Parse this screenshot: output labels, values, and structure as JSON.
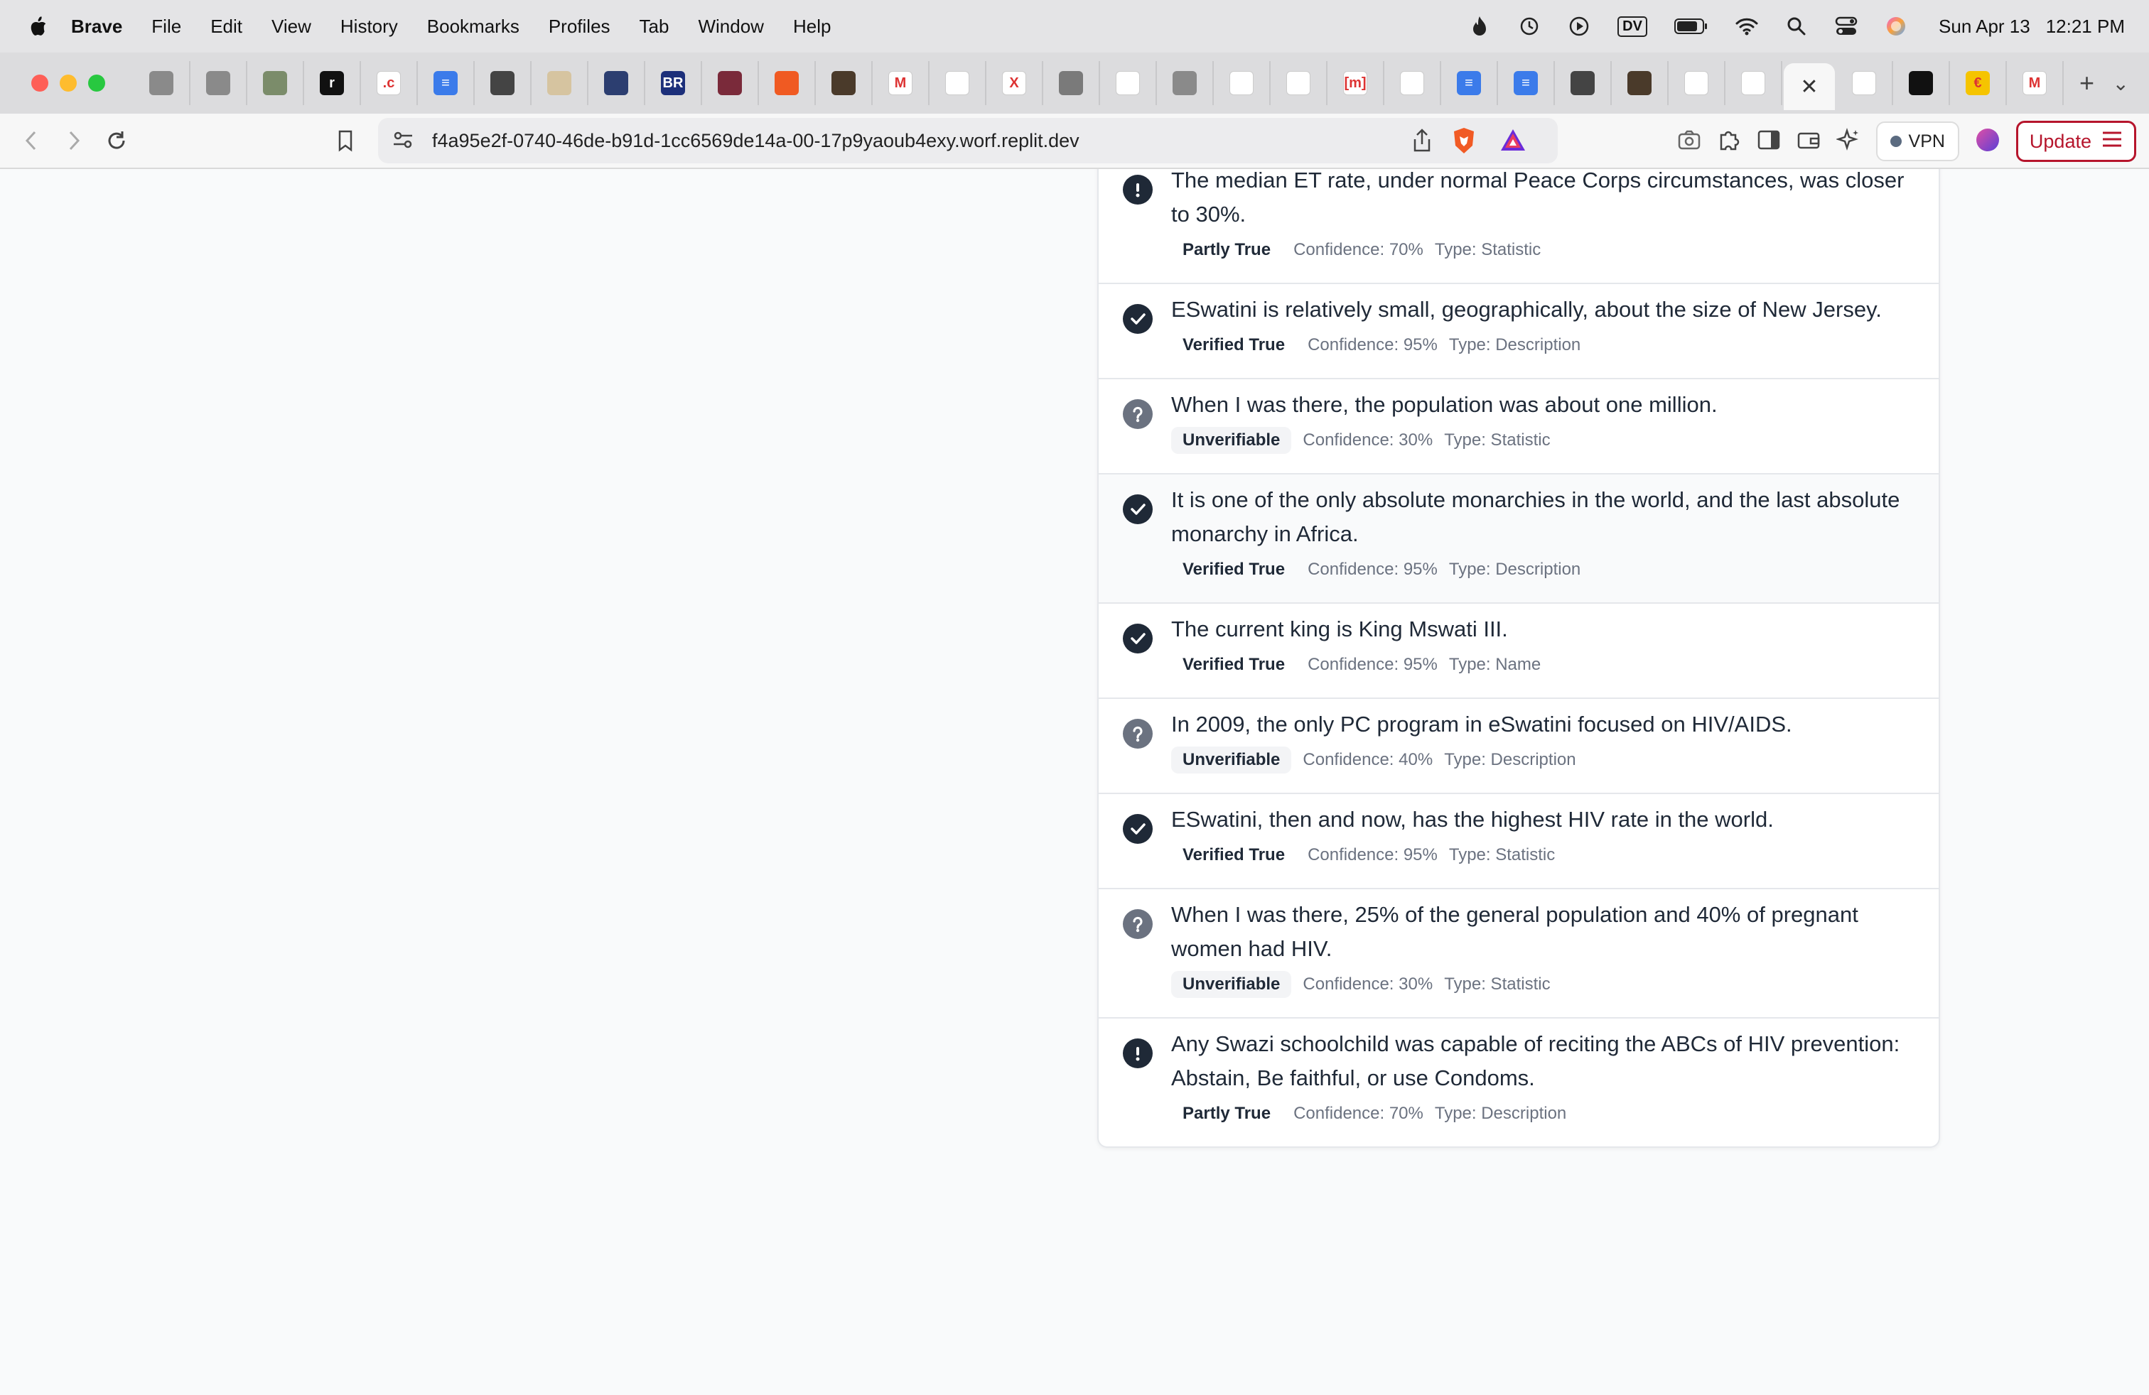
{
  "menubar": {
    "app_name": "Brave",
    "items": [
      "File",
      "Edit",
      "View",
      "History",
      "Bookmarks",
      "Profiles",
      "Tab",
      "Window",
      "Help"
    ],
    "date": "Sun Apr 13",
    "time": "12:21 PM",
    "status_icons": [
      "flame-icon",
      "history-icon",
      "play-icon",
      "dv-icon",
      "battery-icon",
      "wifi-icon",
      "spotlight-search-icon",
      "control-center-icon",
      "siri-icon"
    ],
    "dv_label": "DV"
  },
  "tabs": {
    "favicon_glyphs": [
      "",
      "",
      "",
      "r",
      ".c",
      "≡",
      "",
      "",
      "",
      "BR",
      "",
      "",
      "",
      "M",
      "",
      "X",
      "",
      "",
      "",
      "",
      "",
      "[m]",
      "",
      "≡",
      "≡",
      "",
      "",
      "",
      "",
      "",
      "",
      "€",
      "M"
    ],
    "favicon_colors": [
      "#8a8a8a",
      "#8a8a8a",
      "#7b8c6a",
      "#111111",
      "#ffffff",
      "#3b7bea",
      "#444444",
      "#d6c4a0",
      "#2c3e70",
      "#1c2f7a",
      "#7a2a3a",
      "#f05a22",
      "#4a3a2a",
      "#ffffff",
      "#ffffff",
      "#ffffff",
      "#7a7a7a",
      "#ffffff",
      "#8a8a8a",
      "#ffffff",
      "#ffffff",
      "#ffffff",
      "#ffffff",
      "#3b7bea",
      "#3b7bea",
      "#444444",
      "#4a3a2a",
      "#ffffff",
      "#ffffff",
      "#ffffff",
      "#111111",
      "#f5c400",
      "#ffffff"
    ],
    "active_close": "✕",
    "new_tab": "+",
    "menu": "⌄"
  },
  "toolbar": {
    "url": "f4a95e2f-0740-46de-b91d-1cc6569de14a-00-17p9yaoub4exy.worf.replit.dev",
    "vpn_label": "VPN",
    "update_label": "Update"
  },
  "claims": [
    {
      "text": "The median ET rate, under normal Peace Corps circumstances, was closer to 30%.",
      "verdict": "Partly True",
      "verdict_type": "partly",
      "confidence": "Confidence: 70%",
      "type": "Type: Statistic",
      "icon": "exclamation-icon"
    },
    {
      "text": "ESwatini is relatively small, geographically, about the size of New Jersey.",
      "verdict": "Verified True",
      "verdict_type": "verified",
      "confidence": "Confidence: 95%",
      "type": "Type: Description",
      "icon": "checkmark-icon"
    },
    {
      "text": "When I was there, the population was about one million.",
      "verdict": "Unverifiable",
      "verdict_type": "unver",
      "confidence": "Confidence: 30%",
      "type": "Type: Statistic",
      "icon": "question-icon"
    },
    {
      "text": "It is one of the only absolute monarchies in the world, and the last absolute monarchy in Africa.",
      "verdict": "Verified True",
      "verdict_type": "verified",
      "confidence": "Confidence: 95%",
      "type": "Type: Description",
      "icon": "checkmark-icon",
      "highlighted": true
    },
    {
      "text": "The current king is King Mswati III.",
      "verdict": "Verified True",
      "verdict_type": "verified",
      "confidence": "Confidence: 95%",
      "type": "Type: Name",
      "icon": "checkmark-icon"
    },
    {
      "text": "In 2009, the only PC program in eSwatini focused on HIV/AIDS.",
      "verdict": "Unverifiable",
      "verdict_type": "unver",
      "confidence": "Confidence: 40%",
      "type": "Type: Description",
      "icon": "question-icon"
    },
    {
      "text": "ESwatini, then and now, has the highest HIV rate in the world.",
      "verdict": "Verified True",
      "verdict_type": "verified",
      "confidence": "Confidence: 95%",
      "type": "Type: Statistic",
      "icon": "checkmark-icon"
    },
    {
      "text": "When I was there, 25% of the general population and 40% of pregnant women had HIV.",
      "verdict": "Unverifiable",
      "verdict_type": "unver",
      "confidence": "Confidence: 30%",
      "type": "Type: Statistic",
      "icon": "question-icon"
    },
    {
      "text": "Any Swazi schoolchild was capable of reciting the ABCs of HIV prevention: Abstain, Be faithful, or use Condoms.",
      "verdict": "Partly True",
      "verdict_type": "partly",
      "confidence": "Confidence: 70%",
      "type": "Type: Description",
      "icon": "exclamation-icon"
    }
  ]
}
